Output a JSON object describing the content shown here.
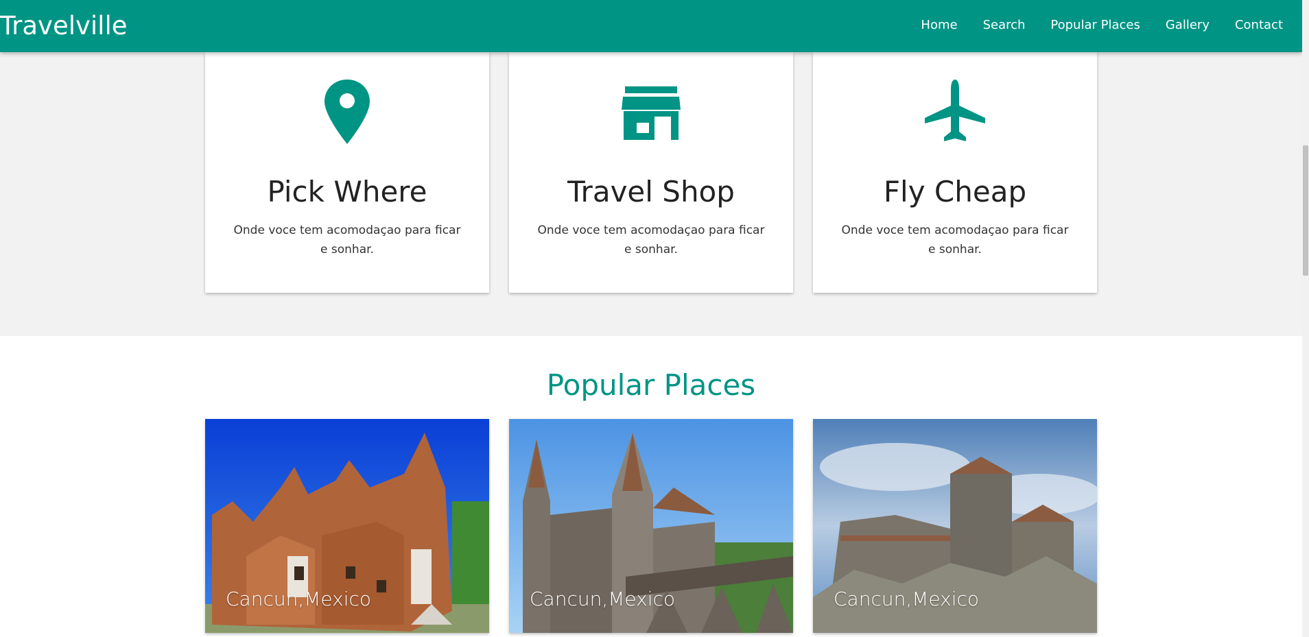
{
  "nav": {
    "brand": "Travelville",
    "links": [
      "Home",
      "Search",
      "Popular Places",
      "Gallery",
      "Contact"
    ],
    "color": "#009484"
  },
  "features": [
    {
      "icon": "map-pin-icon",
      "title": "Pick Where",
      "description": "Onde voce tem acomodaçao para ficar e sonhar."
    },
    {
      "icon": "store-icon",
      "title": "Travel Shop",
      "description": "Onde voce tem acomodaçao para ficar e sonhar."
    },
    {
      "icon": "airplane-icon",
      "title": "Fly Cheap",
      "description": "Onde voce tem acomodaçao para ficar e sonhar."
    }
  ],
  "popular": {
    "title": "Popular Places",
    "places": [
      {
        "label": "Cancun,Mexico",
        "image": "clay-castle-photo"
      },
      {
        "label": "Cancun,Mexico",
        "image": "gothic-castle-photo"
      },
      {
        "label": "Cancun,Mexico",
        "image": "bran-castle-photo"
      }
    ]
  },
  "colors": {
    "accent": "#009484",
    "features_bg": "#f2f2f2"
  }
}
